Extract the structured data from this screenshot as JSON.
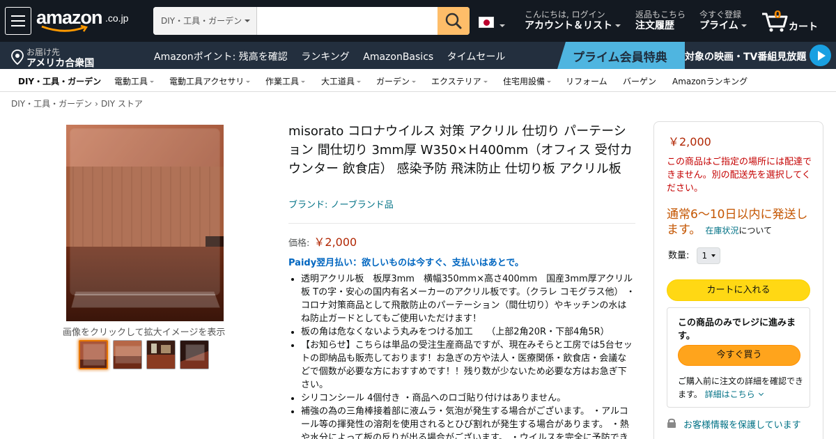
{
  "header": {
    "logo_word": "amazon",
    "logo_tld": ".co.jp",
    "search_category": "DIY・工具・ガーデン",
    "search_placeholder": "",
    "account_line1": "こんにちは, ログイン",
    "account_line2": "アカウント＆リスト",
    "orders_line1": "返品もこちら",
    "orders_line2": "注文履歴",
    "prime_line1": "今すぐ登録",
    "prime_line2": "プライム",
    "cart_count": "0",
    "cart_label": "カート"
  },
  "nav": {
    "deliver_line1": "お届け先",
    "deliver_line2": "アメリカ合衆国",
    "links": [
      "Amazonポイント: 残高を確認",
      "ランキング",
      "AmazonBasics",
      "タイムセール"
    ],
    "promo_banner": "プライム会員特典",
    "promo_text": "対象の映画・TV番組見放題"
  },
  "subnav": {
    "items": [
      "DIY・工具・ガーデン",
      "電動工具",
      "電動工具アクセサリ",
      "作業工具",
      "大工道具",
      "ガーデン",
      "エクステリア",
      "住宅用設備",
      "リフォーム",
      "バーゲン",
      "Amazonランキング"
    ]
  },
  "breadcrumb": [
    "DIY・工具・ガーデン",
    "DIY ストア"
  ],
  "gallery": {
    "caption": "画像をクリックして拡大イメージを表示"
  },
  "product": {
    "title": "misorato コロナウイルス 対策 アクリル 仕切り パーテーション 間仕切り 3mm厚 W350×Ｈ400mm（オフィス 受付カウンター 飲食店） 感染予防 飛沫防止 仕切り板 アクリル板",
    "brand": "ブランド: ノーブランド品",
    "price_label": "価格:",
    "price": "￥2,000",
    "paidy": "Paidy翌月払い：欲しいものは今すぐ、支払いはあとで。",
    "bullets": [
      "透明アクリル板　板厚3mm　横幅350mm×高さ400mm　国産3mm厚アクリル板 Tの字・安心の国内有名メーカーのアクリル板です。（クラレ コモグラス他） ・コロナ対策商品として飛散防止のパーテーション（間仕切り）やキッチンの水はね防止ガードとしてもご使用いただけます！",
      "板の角は危なくないよう丸みをつける加工　　（上部2角20R・下部4角5R）",
      "【お知らせ】こちらは単品の受注生産商品ですが、現在みそらと工房では5台セットの即納品も販売しております！お急ぎの方や法人・医療関係・飲食店・会議などで個数が必要な方におすすめです！！残り数が少ないため必要な方はお急ぎ下さい。",
      "シリコンシール 4個付き ・商品へのロゴ貼り付けはありません。",
      "補強の為の三角棒接着部に液ムラ・気泡が発生する場合がございます。 ・アルコール等の揮発性の溶剤を使用されるとひび割れが発生する場合があります。 ・熱や水分によって板の反りが出る場合がございます。 ・ウイルスを完全に予防できるものではありません。"
    ]
  },
  "buybox": {
    "price": "￥2,000",
    "warning": "この商品はご指定の場所には配達できません。別の配送先を選択してください。",
    "shipping": "通常6～10日以内に発送します。",
    "stock_link": "在庫状況",
    "stock_suffix": "について",
    "qty_label": "数量:",
    "qty_value": "1",
    "add_to_cart": "カートに入れる",
    "oneclick_heading": "この商品のみでレジに進みます。",
    "buy_now": "今すぐ買う",
    "oneclick_note": "ご購入前に注文の詳細を確認できます。",
    "details_link": "詳細はこちら",
    "secure": "お客様情報を保護しています"
  }
}
